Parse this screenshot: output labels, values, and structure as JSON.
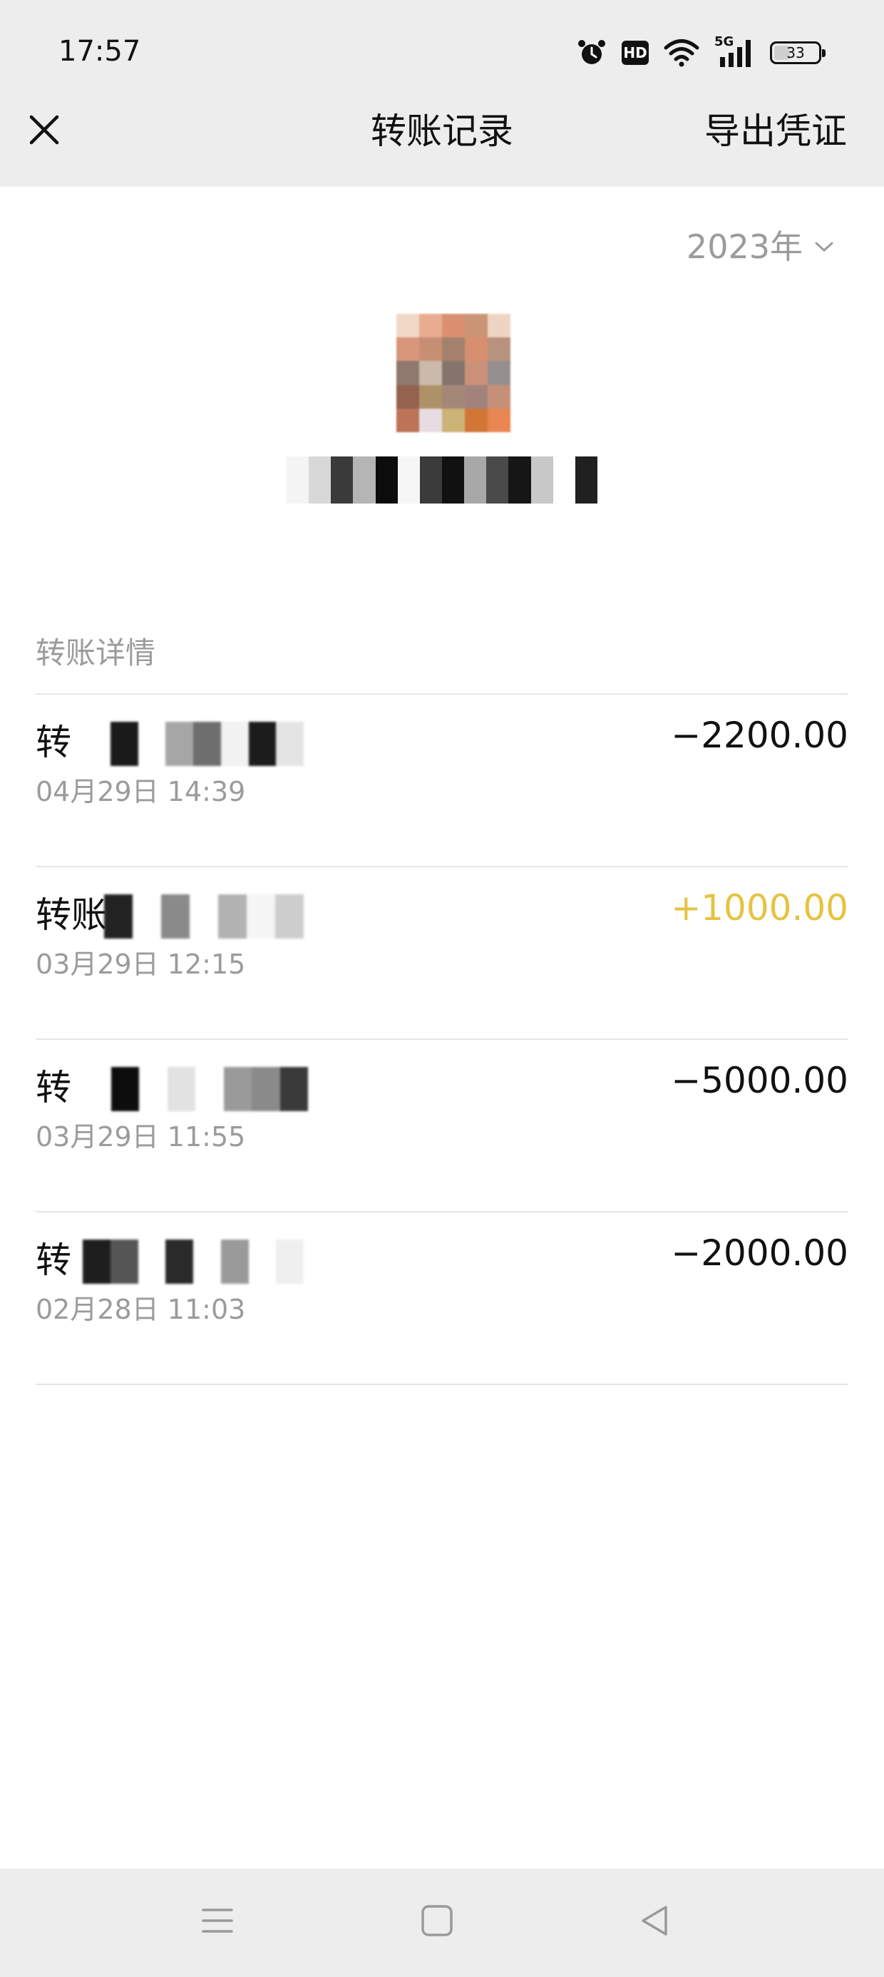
{
  "status_bar": {
    "time": "17:57",
    "hd_label": "HD",
    "network_label": "5G",
    "battery_level": "33",
    "icons": [
      "alarm-icon",
      "hd-icon",
      "wifi-icon",
      "5g-signal-icon",
      "battery-icon"
    ]
  },
  "header": {
    "title": "转账记录",
    "export_label": "导出凭证",
    "close_icon": "close-icon"
  },
  "year_filter": {
    "label": "2023年",
    "icon": "chevron-down-icon"
  },
  "counterpart": {
    "avatar_note": "pixelated",
    "name_note": "pixelated"
  },
  "section": {
    "title": "转账详情"
  },
  "transactions": [
    {
      "title": "转",
      "time": "04月29日 14:39",
      "amount": "−2200.00",
      "type": "expense"
    },
    {
      "title": "转账",
      "time": "03月29日 12:15",
      "amount": "+1000.00",
      "type": "income"
    },
    {
      "title": "转",
      "time": "03月29日 11:55",
      "amount": "−5000.00",
      "type": "expense"
    },
    {
      "title": "转",
      "time": "02月28日 11:03",
      "amount": "−2000.00",
      "type": "expense"
    }
  ],
  "colors": {
    "income": "#e6c341",
    "secondary_text": "#9b9b9b",
    "header_bg": "#ededed"
  },
  "nav_bar": {
    "icons": [
      "menu-icon",
      "home-icon",
      "back-icon"
    ]
  }
}
